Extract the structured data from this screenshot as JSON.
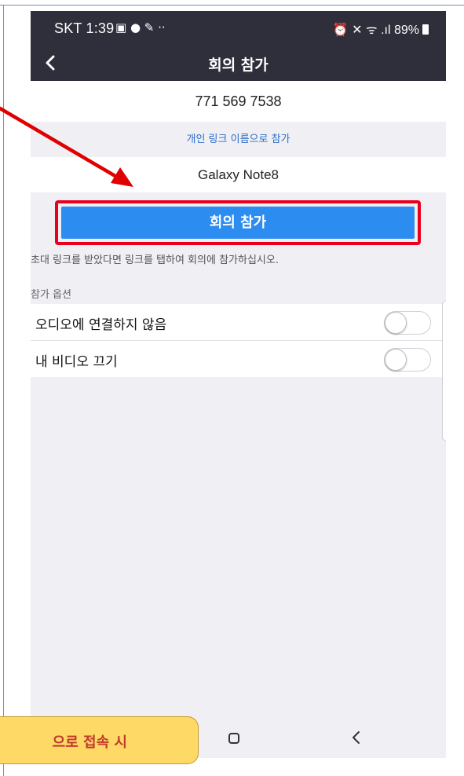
{
  "status_bar": {
    "carrier_time": "SKT 1:39",
    "left_icons": "▣ ● ✎ ··",
    "right_status": "⏰ ✕ ᯤ .ıl 89%"
  },
  "header": {
    "title": "회의 참가"
  },
  "form": {
    "meeting_id": "771 569 7538",
    "personal_link_label": "개인 링크 이름으로 참가",
    "display_name": "Galaxy Note8"
  },
  "join_button_label": "회의 참가",
  "hint_text": "초대 링크를 받았다면 링크를 탭하여 회의에 참가하십시오.",
  "options": {
    "section_label": "참가 옵션",
    "items": [
      {
        "label": "오디오에 연결하지 않음",
        "enabled": false
      },
      {
        "label": "내 비디오 끄기",
        "enabled": false
      }
    ]
  },
  "callout": {
    "text": "으로 접속 시"
  },
  "colors": {
    "header_bg": "#2e2f3a",
    "accent_blue": "#2d8cf0",
    "highlight_red": "#e8001c",
    "callout_yellow": "#ffd966"
  }
}
